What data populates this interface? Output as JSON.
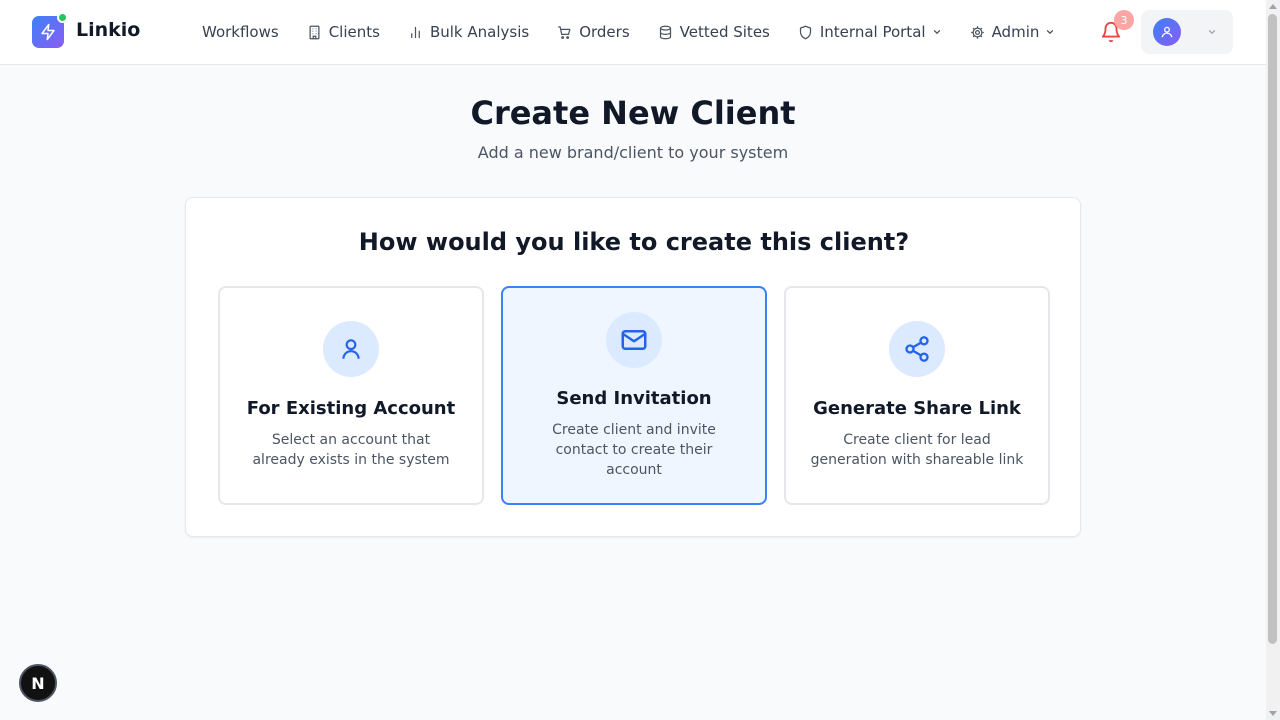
{
  "app": {
    "name": "Linkio",
    "notification_count": "3",
    "brand_gradient": [
      "#3b82f6",
      "#8b5cf6"
    ],
    "accent": "#2563eb"
  },
  "nav": [
    {
      "label": "Workflows",
      "icon": "none"
    },
    {
      "label": "Clients",
      "icon": "building-icon"
    },
    {
      "label": "Bulk Analysis",
      "icon": "bar-chart-icon"
    },
    {
      "label": "Orders",
      "icon": "cart-icon"
    },
    {
      "label": "Vetted Sites",
      "icon": "database-icon"
    },
    {
      "label": "Internal Portal",
      "icon": "shield-icon",
      "dropdown": true
    },
    {
      "label": "Admin",
      "icon": "gear-icon",
      "dropdown": true
    }
  ],
  "page": {
    "title": "Create New Client",
    "subtitle": "Add a new brand/client to your system"
  },
  "panel": {
    "question": "How would you like to create this client?",
    "options": [
      {
        "title": "For Existing Account",
        "description": "Select an account that already exists in the system",
        "icon": "user-icon",
        "selected": false
      },
      {
        "title": "Send Invitation",
        "description": "Create client and invite contact to create their account",
        "icon": "mail-icon",
        "selected": true
      },
      {
        "title": "Generate Share Link",
        "description": "Create client for lead generation with shareable link",
        "icon": "share-icon",
        "selected": false
      }
    ]
  },
  "dev_badge": {
    "label": "N"
  }
}
